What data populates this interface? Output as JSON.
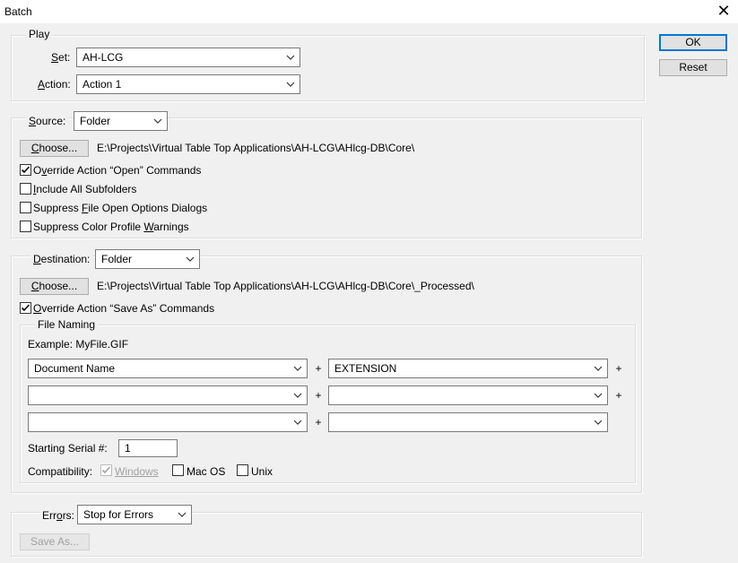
{
  "window": {
    "title": "Batch",
    "close_glyph": "✕"
  },
  "buttons": {
    "ok": "OK",
    "reset": "Reset"
  },
  "play": {
    "legend": "Play",
    "set_label": [
      "",
      "S",
      "et:"
    ],
    "set_value": "AH-LCG",
    "action_label": [
      "",
      "A",
      "ction:"
    ],
    "action_value": "Action 1"
  },
  "source": {
    "label": [
      "",
      "S",
      "ource:"
    ],
    "value": "Folder",
    "choose": [
      "",
      "C",
      "hoose..."
    ],
    "path": "E:\\Projects\\Virtual Table Top Applications\\AH-LCG\\AHlcg-DB\\Core\\",
    "options": [
      {
        "pre": "O",
        "u": "v",
        "post": "erride Action “Open” Commands",
        "checked": true
      },
      {
        "pre": "",
        "u": "I",
        "post": "nclude All Subfolders",
        "checked": false
      },
      {
        "pre": "Suppress ",
        "u": "F",
        "post": "ile Open Options Dialogs",
        "checked": false
      },
      {
        "pre": "Suppress Color Profile ",
        "u": "W",
        "post": "arnings",
        "checked": false
      }
    ]
  },
  "destination": {
    "label": [
      "",
      "D",
      "estination:"
    ],
    "value": "Folder",
    "choose": [
      "",
      "C",
      "hoose..."
    ],
    "path": "E:\\Projects\\Virtual Table Top Applications\\AH-LCG\\AHlcg-DB\\Core\\_Processed\\",
    "override": {
      "pre": "",
      "u": "O",
      "post": "verride Action “Save As” Commands",
      "checked": true
    },
    "file_naming": {
      "legend": "File Naming",
      "example": "Example: MyFile.GIF",
      "fields": [
        [
          "Document Name",
          "EXTENSION"
        ],
        [
          "",
          ""
        ],
        [
          "",
          ""
        ]
      ],
      "plus": "+",
      "serial_label": "Starting Serial #:",
      "serial_value": "1",
      "compat_label": "Compatibility:",
      "compat": [
        {
          "label": "Windows",
          "u_index": 0,
          "checked": true,
          "disabled": true
        },
        {
          "label": "Mac OS",
          "u_index": 0,
          "checked": false,
          "disabled": false
        },
        {
          "label": "Unix",
          "u_index": 0,
          "checked": false,
          "disabled": false
        }
      ]
    }
  },
  "errors": {
    "label": [
      "Err",
      "o",
      "rs:"
    ],
    "value": "Stop for Errors",
    "save_as": "Save As..."
  },
  "icons": {
    "chevron": "chevron-down-icon",
    "check": "checkmark-icon"
  }
}
